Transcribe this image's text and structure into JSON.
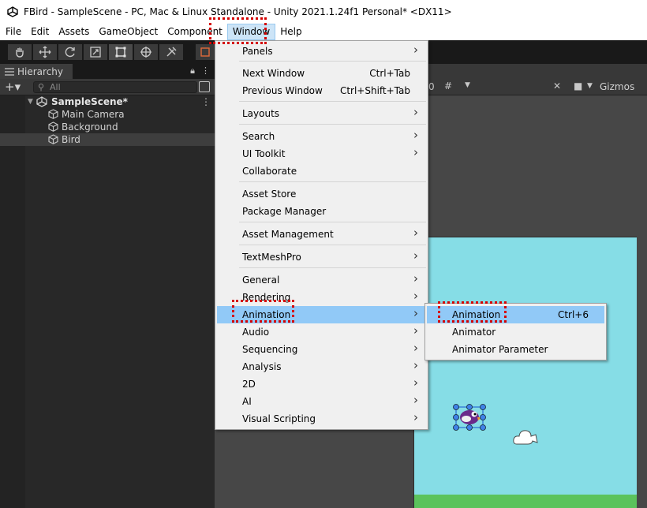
{
  "titlebar": {
    "title": "FBird - SampleScene - PC, Mac & Linux Standalone - Unity 2021.1.24f1 Personal* <DX11>"
  },
  "menubar": {
    "items": [
      "File",
      "Edit",
      "Assets",
      "GameObject",
      "Component",
      "Window",
      "Help"
    ]
  },
  "toolbar": {
    "tools": [
      "hand-tool",
      "move-tool",
      "rotate-tool",
      "scale-tool",
      "rect-tool",
      "transform-tool",
      "custom-tool"
    ]
  },
  "hierarchy": {
    "tab_label": "Hierarchy",
    "search_placeholder": "All",
    "scene_name": "SampleScene*",
    "objects": [
      "Main Camera",
      "Background",
      "Bird"
    ]
  },
  "scene_toolbar": {
    "layer_count": "0",
    "gizmos_label": "Gizmos"
  },
  "window_menu": {
    "items": [
      {
        "label": "Panels",
        "shortcut": "",
        "submenu": true
      },
      {
        "label": "Next Window",
        "shortcut": "Ctrl+Tab",
        "submenu": false
      },
      {
        "label": "Previous Window",
        "shortcut": "Ctrl+Shift+Tab",
        "submenu": false
      },
      {
        "label": "Layouts",
        "shortcut": "",
        "submenu": true
      },
      {
        "label": "Search",
        "shortcut": "",
        "submenu": true
      },
      {
        "label": "UI Toolkit",
        "shortcut": "",
        "submenu": true
      },
      {
        "label": "Collaborate",
        "shortcut": "",
        "submenu": false
      },
      {
        "label": "Asset Store",
        "shortcut": "",
        "submenu": false
      },
      {
        "label": "Package Manager",
        "shortcut": "",
        "submenu": false
      },
      {
        "label": "Asset Management",
        "shortcut": "",
        "submenu": true
      },
      {
        "label": "TextMeshPro",
        "shortcut": "",
        "submenu": true
      },
      {
        "label": "General",
        "shortcut": "",
        "submenu": true
      },
      {
        "label": "Rendering",
        "shortcut": "",
        "submenu": true
      },
      {
        "label": "Animation",
        "shortcut": "",
        "submenu": true
      },
      {
        "label": "Audio",
        "shortcut": "",
        "submenu": true
      },
      {
        "label": "Sequencing",
        "shortcut": "",
        "submenu": true
      },
      {
        "label": "Analysis",
        "shortcut": "",
        "submenu": true
      },
      {
        "label": "2D",
        "shortcut": "",
        "submenu": true
      },
      {
        "label": "AI",
        "shortcut": "",
        "submenu": true
      },
      {
        "label": "Visual Scripting",
        "shortcut": "",
        "submenu": true
      }
    ]
  },
  "animation_submenu": {
    "items": [
      {
        "label": "Animation",
        "shortcut": "Ctrl+6"
      },
      {
        "label": "Animator",
        "shortcut": ""
      },
      {
        "label": "Animator Parameter",
        "shortcut": ""
      }
    ]
  },
  "colors": {
    "menu_highlight": "#91c9f7",
    "annotation_red": "#d40000",
    "game_sky": "#86dde6",
    "grass": "#5bc35c"
  }
}
